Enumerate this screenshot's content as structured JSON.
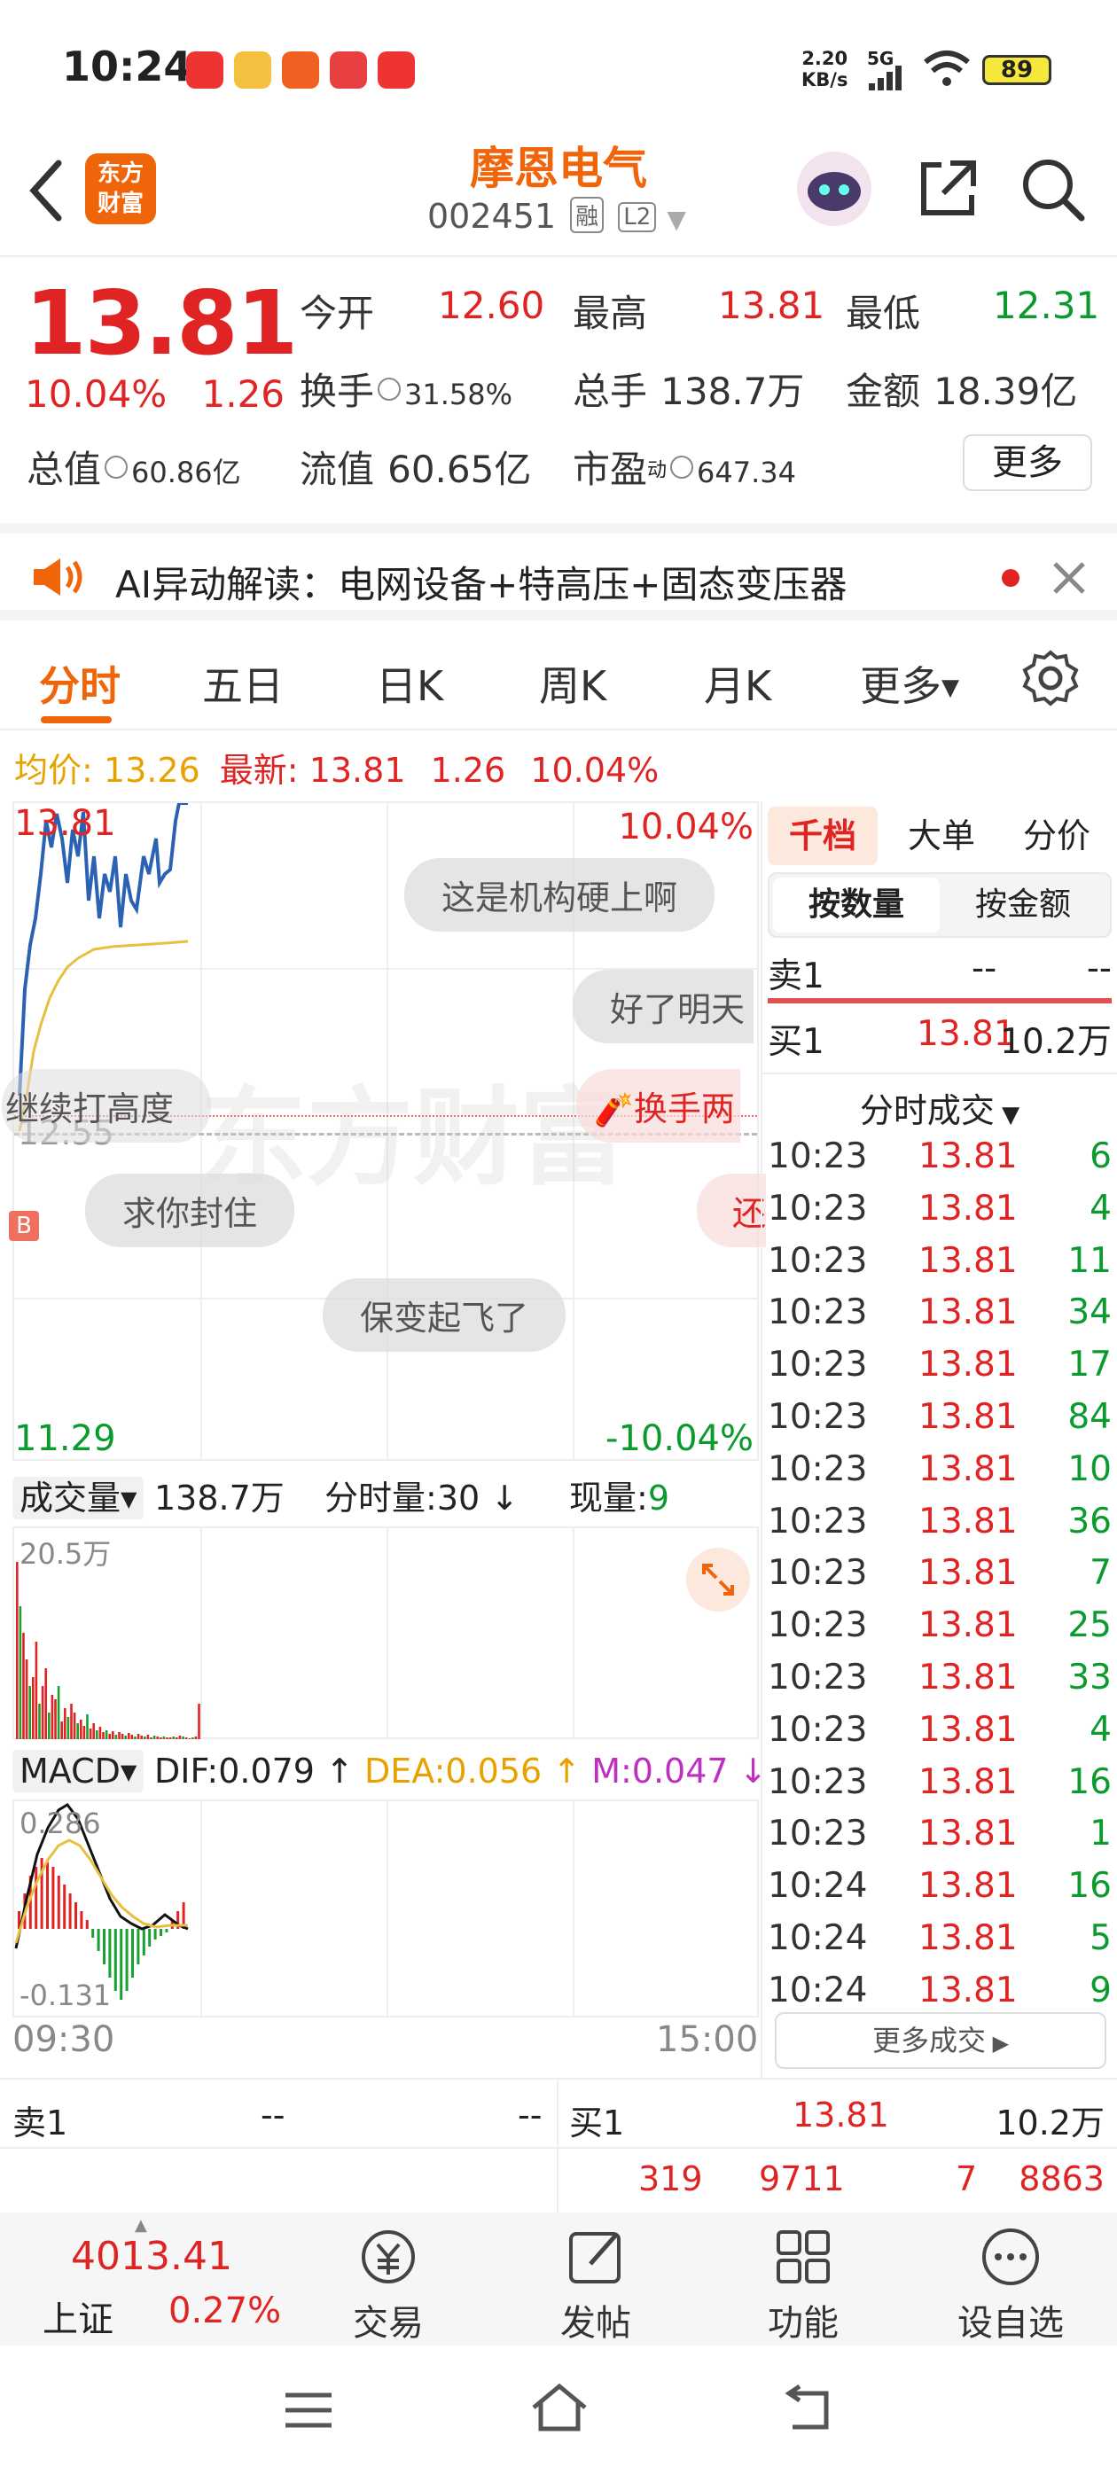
{
  "status_bar": {
    "time": "10:24",
    "net_speed_value": "2.20",
    "net_speed_unit": "KB/s",
    "network": "5G",
    "battery": "89"
  },
  "header": {
    "stock_name": "摩恩电气",
    "stock_code": "002451",
    "tag_margin": "融",
    "tag_level": "L2",
    "logo_line1": "东方",
    "logo_line2": "财富"
  },
  "quote": {
    "price": "13.81",
    "change_pct": "10.04%",
    "change_amt": "1.26",
    "open_label": "今开",
    "open": "12.60",
    "high_label": "最高",
    "high": "13.81",
    "low_label": "最低",
    "low": "12.31",
    "turnover_label": "换手",
    "turnover": "31.58%",
    "volume_label": "总手",
    "volume": "138.7万",
    "amount_label": "金额",
    "amount": "18.39亿",
    "mktcap_label": "总值",
    "mktcap": "60.86亿",
    "float_label": "流值",
    "float": "60.65亿",
    "pe_label": "市盈",
    "pe_sup": "动",
    "pe": "647.34",
    "more": "更多"
  },
  "ai_bar": {
    "text": "AI异动解读：电网设备+特高压+固态变压器"
  },
  "chart_tabs": [
    "分时",
    "五日",
    "日K",
    "周K",
    "月K",
    "更多"
  ],
  "price_line": {
    "avg_label": "均价:",
    "avg": "13.26",
    "latest_label": "最新:",
    "latest": "13.81",
    "change_amt": "1.26",
    "change_pct": "10.04%"
  },
  "chart": {
    "top_price": "13.81",
    "top_pct": "10.04%",
    "bottom_price": "11.29",
    "bottom_pct": "-10.04%",
    "ref_price": "12.55",
    "marker": "B",
    "watermark": "东方财富",
    "comments": [
      "这是机构硬上啊",
      "好了明天",
      "继续打高度",
      "换手两",
      "求你封住",
      "还",
      "保变起飞了"
    ]
  },
  "volume": {
    "label": "成交量",
    "total": "138.7万",
    "period_label": "分时量:",
    "period_value": "30",
    "current_label": "现量:",
    "current_value": "9",
    "max_label": "20.5万"
  },
  "macd": {
    "label": "MACD",
    "dif_label": "DIF:",
    "dif": "0.079",
    "dea_label": "DEA:",
    "dea": "0.056",
    "m_label": "M:",
    "m": "0.047",
    "max_label": "0.286",
    "min_label": "-0.131",
    "time_start": "09:30",
    "time_end": "15:00"
  },
  "right_panel": {
    "tabs": [
      "千档",
      "大单",
      "分价"
    ],
    "segments": [
      "按数量",
      "按金额"
    ],
    "sell1_label": "卖1",
    "sell1_price": "--",
    "sell1_vol": "--",
    "buy1_label": "买1",
    "buy1_price": "13.81",
    "buy1_vol": "10.2万",
    "ticks_title": "分时成交",
    "ticks": [
      {
        "time": "10:23",
        "price": "13.81",
        "vol": "6"
      },
      {
        "time": "10:23",
        "price": "13.81",
        "vol": "4"
      },
      {
        "time": "10:23",
        "price": "13.81",
        "vol": "11"
      },
      {
        "time": "10:23",
        "price": "13.81",
        "vol": "34"
      },
      {
        "time": "10:23",
        "price": "13.81",
        "vol": "17"
      },
      {
        "time": "10:23",
        "price": "13.81",
        "vol": "84"
      },
      {
        "time": "10:23",
        "price": "13.81",
        "vol": "10"
      },
      {
        "time": "10:23",
        "price": "13.81",
        "vol": "36"
      },
      {
        "time": "10:23",
        "price": "13.81",
        "vol": "7"
      },
      {
        "time": "10:23",
        "price": "13.81",
        "vol": "25"
      },
      {
        "time": "10:23",
        "price": "13.81",
        "vol": "33"
      },
      {
        "time": "10:23",
        "price": "13.81",
        "vol": "4"
      },
      {
        "time": "10:23",
        "price": "13.81",
        "vol": "16"
      },
      {
        "time": "10:23",
        "price": "13.81",
        "vol": "1"
      },
      {
        "time": "10:24",
        "price": "13.81",
        "vol": "16"
      },
      {
        "time": "10:24",
        "price": "13.81",
        "vol": "5"
      },
      {
        "time": "10:24",
        "price": "13.81",
        "vol": "9"
      }
    ],
    "more_ticks": "更多成交"
  },
  "book_bar": {
    "sell1_label": "卖1",
    "sell1_price": "--",
    "sell1_vol": "--",
    "buy1_label": "买1",
    "buy1_price": "13.81",
    "buy1_vol": "10.2万",
    "n1": "319",
    "n2": "9711",
    "n3": "7",
    "n4": "8863"
  },
  "bottom_nav": {
    "index_value": "4013.41",
    "index_name": "上证",
    "index_pct": "0.27%",
    "items": [
      "交易",
      "发帖",
      "功能",
      "设自选"
    ]
  }
}
